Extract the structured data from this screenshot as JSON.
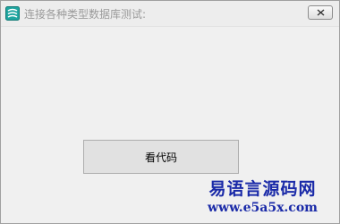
{
  "window": {
    "title": "连接各种类型数据库测试:"
  },
  "main": {
    "view_code_button": "看代码"
  },
  "watermark": {
    "site_name": "易语言源码网",
    "url": "www.e5a5x.com"
  },
  "colors": {
    "window_bg": "#f0f0f0",
    "watermark": "#1a2aa8",
    "title_text": "#9a9a9a"
  },
  "icons": {
    "app": "app-icon",
    "close": "close-icon"
  }
}
